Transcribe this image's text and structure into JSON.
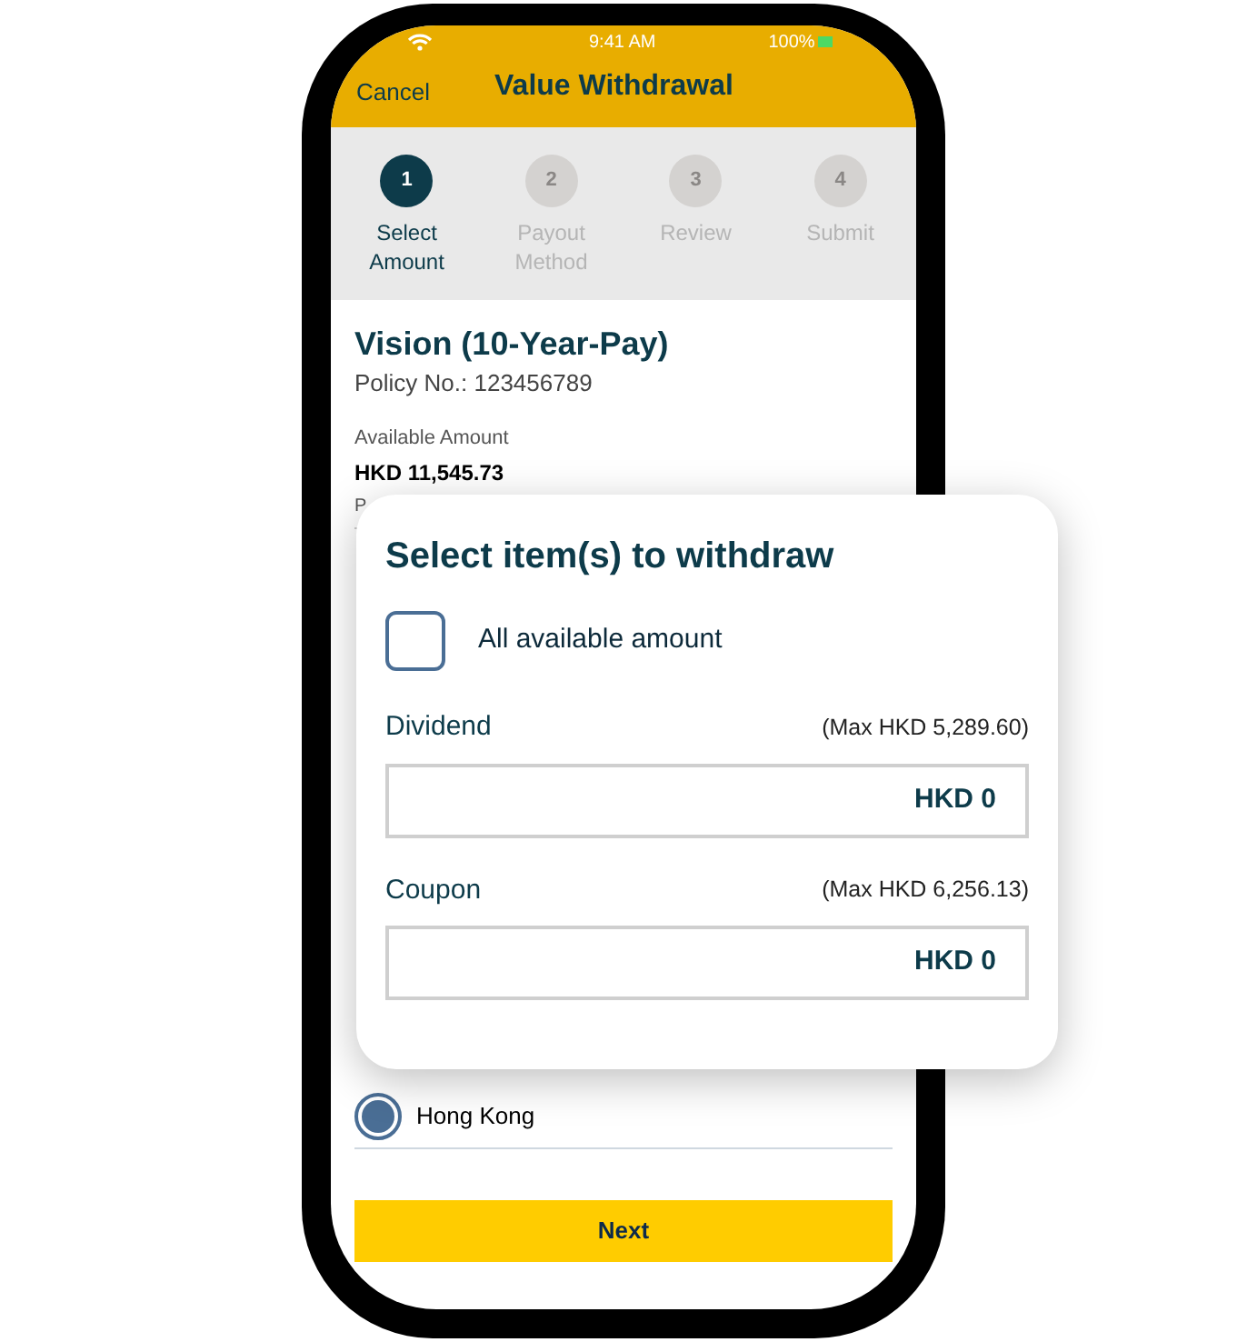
{
  "status_bar": {
    "time": "9:41 AM",
    "battery": "100%"
  },
  "header": {
    "cancel": "Cancel",
    "title": "Value Withdrawal"
  },
  "steps": [
    {
      "number": "1",
      "label": "Select Amount",
      "selected": true
    },
    {
      "number": "2",
      "label": "Payout Method",
      "selected": false
    },
    {
      "number": "3",
      "label": "Review",
      "selected": false
    },
    {
      "number": "4",
      "label": "Submit",
      "selected": false
    }
  ],
  "policy": {
    "name": "Vision (10-Year-Pay)",
    "number": "Policy No.: 123456789",
    "available_label": "Available Amount",
    "available_value": "HKD 11,545.73",
    "cut_label": "P"
  },
  "payout_region": {
    "options": [
      {
        "label": "Hong Kong",
        "selected": true
      }
    ]
  },
  "next_button": "Next",
  "dialog": {
    "title": "Select item(s) to withdraw",
    "all_option": {
      "label": "All available amount",
      "checked": false
    },
    "items": [
      {
        "label": "Dividend",
        "max": "(Max HKD 5,289.60)",
        "value": "HKD 0"
      },
      {
        "label": "Coupon",
        "max": "(Max HKD 6,256.13)",
        "value": "HKD 0"
      }
    ]
  }
}
